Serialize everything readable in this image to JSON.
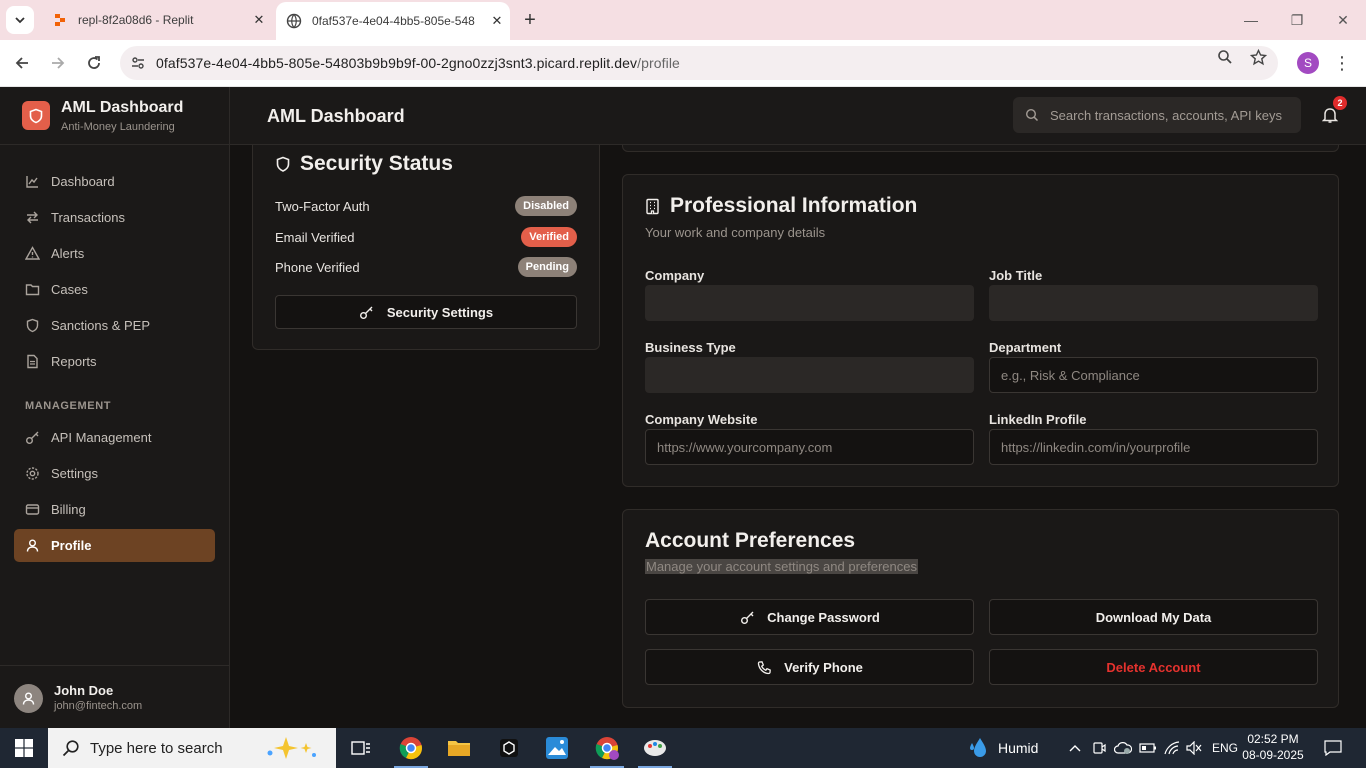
{
  "browser": {
    "tabs": [
      {
        "title": "repl-8f2a08d6 - Replit",
        "active": false
      },
      {
        "title": "0faf537e-4e04-4bb5-805e-548",
        "active": true
      }
    ],
    "url_host": "0faf537e-4e04-4bb5-805e-54803b9b9b9f-00-2gno0zzj3snt3.picard.replit.dev",
    "url_path": "/profile",
    "profile_initial": "S"
  },
  "sidebar": {
    "brand_title": "AML Dashboard",
    "brand_subtitle": "Anti-Money Laundering",
    "items": [
      {
        "label": "Dashboard",
        "icon": "chart-line-icon"
      },
      {
        "label": "Transactions",
        "icon": "arrows-icon"
      },
      {
        "label": "Alerts",
        "icon": "alert-triangle-icon"
      },
      {
        "label": "Cases",
        "icon": "folder-icon"
      },
      {
        "label": "Sanctions & PEP",
        "icon": "shield-icon"
      },
      {
        "label": "Reports",
        "icon": "file-icon"
      }
    ],
    "management_label": "MANAGEMENT",
    "management_items": [
      {
        "label": "API Management",
        "icon": "key-icon"
      },
      {
        "label": "Settings",
        "icon": "gear-icon"
      },
      {
        "label": "Billing",
        "icon": "card-icon"
      },
      {
        "label": "Profile",
        "icon": "user-icon",
        "active": true
      }
    ],
    "user": {
      "name": "John Doe",
      "email": "john@fintech.com"
    }
  },
  "header": {
    "title": "AML Dashboard",
    "search_placeholder": "Search transactions, accounts, API keys",
    "notification_count": "2"
  },
  "security": {
    "title": "Security Status",
    "rows": [
      {
        "label": "Two-Factor Auth",
        "status": "Disabled",
        "tone": "gray"
      },
      {
        "label": "Email Verified",
        "status": "Verified",
        "tone": "red"
      },
      {
        "label": "Phone Verified",
        "status": "Pending",
        "tone": "gray"
      }
    ],
    "settings_button": "Security Settings"
  },
  "professional": {
    "title": "Professional Information",
    "subtitle": "Your work and company details",
    "fields": {
      "company": {
        "label": "Company",
        "value": ""
      },
      "job_title": {
        "label": "Job Title",
        "value": ""
      },
      "business_type": {
        "label": "Business Type",
        "value": ""
      },
      "department": {
        "label": "Department",
        "placeholder": "e.g., Risk & Compliance"
      },
      "website": {
        "label": "Company Website",
        "placeholder": "https://www.yourcompany.com"
      },
      "linkedin": {
        "label": "LinkedIn Profile",
        "placeholder": "https://linkedin.com/in/yourprofile"
      }
    }
  },
  "preferences": {
    "title": "Account Preferences",
    "subtitle": "Manage your account settings and preferences",
    "buttons": {
      "change_password": "Change Password",
      "download_data": "Download My Data",
      "verify_phone": "Verify Phone",
      "delete_account": "Delete Account"
    }
  },
  "taskbar": {
    "search_placeholder": "Type here to search",
    "weather": "Humid",
    "language": "ENG",
    "time": "02:52 PM",
    "date": "08-09-2025"
  },
  "colors": {
    "accent": "#e35f4a",
    "active_nav": "#6d4323",
    "danger": "#e5322e",
    "background": "#141211"
  }
}
